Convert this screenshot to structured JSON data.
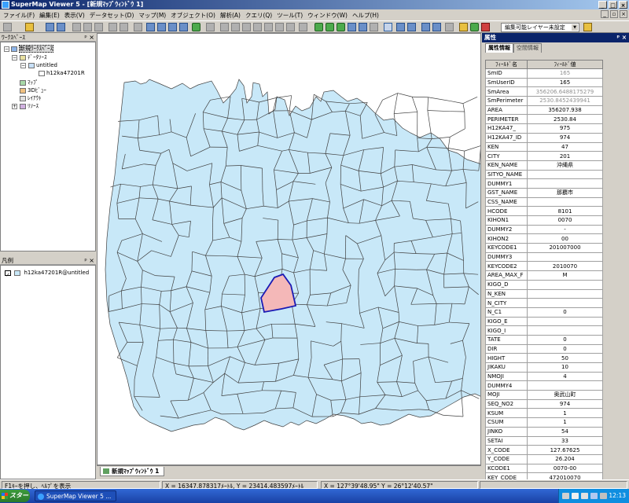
{
  "window": {
    "title": "SuperMap Viewer 5 - [新規ﾏｯﾌﾟｳｨﾝﾄﾞｳ 1]"
  },
  "menu": [
    "ファイル(F)",
    "編集(E)",
    "表示(V)",
    "データセット(D)",
    "マップ(M)",
    "オブジェクト(O)",
    "解析(A)",
    "クエリ(Q)",
    "ツール(T)",
    "ウィンドウ(W)",
    "ヘルプ(H)"
  ],
  "toolbar": {
    "layer_select": "編集可能レイヤー未設定"
  },
  "workspace": {
    "title": "ﾜｰｸｽﾍﾟｰｽ",
    "tree": {
      "root": "新規ﾜｰｸｽﾍﾟｰｽ",
      "datasource": "ﾃﾞｰﾀｿｰｽ",
      "untitled": "untitled",
      "dataset": "h12ka47201R",
      "map": "ﾏｯﾌﾟ",
      "scene": "3Dﾋﾞｭｰ",
      "layout": "ﾚｲｱｳﾄ",
      "resource": "ﾘｿｰｽ"
    }
  },
  "legend": {
    "title": "凡例",
    "item": "h12ka47201R@untitled"
  },
  "map_tab": "新規ﾏｯﾌﾟｳｨﾝﾄﾞｳ 1",
  "attributes": {
    "title": "属性",
    "tabs": [
      "属性情報",
      "空間情報"
    ],
    "columns": [
      "ﾌｨｰﾙﾄﾞ名",
      "ﾌｨｰﾙﾄﾞ値"
    ],
    "rows": [
      [
        "SmID",
        "165"
      ],
      [
        "SmUserID",
        "165"
      ],
      [
        "SmArea",
        "356206.6488175279"
      ],
      [
        "SmPerimeter",
        "2530.8452439941"
      ],
      [
        "AREA",
        "356207.938"
      ],
      [
        "PERIMETER",
        "2530.84"
      ],
      [
        "H12KA47_",
        "975"
      ],
      [
        "H12KA47_ID",
        "974"
      ],
      [
        "KEN",
        "47"
      ],
      [
        "CITY",
        "201"
      ],
      [
        "KEN_NAME",
        "沖縄県"
      ],
      [
        "SITYO_NAME",
        ""
      ],
      [
        "DUMMY1",
        ""
      ],
      [
        "GST_NAME",
        "那覇市"
      ],
      [
        "CSS_NAME",
        ""
      ],
      [
        "HCODE",
        "8101"
      ],
      [
        "KIHON1",
        "0070"
      ],
      [
        "DUMMY2",
        "-"
      ],
      [
        "KIHON2",
        "00"
      ],
      [
        "KEYCODE1",
        "201007000"
      ],
      [
        "DUMMY3",
        ""
      ],
      [
        "KEYCODE2",
        "2010070"
      ],
      [
        "AREA_MAX_F",
        "M"
      ],
      [
        "KIGO_D",
        ""
      ],
      [
        "N_KEN",
        ""
      ],
      [
        "N_CITY",
        ""
      ],
      [
        "N_C1",
        "0"
      ],
      [
        "KIGO_E",
        ""
      ],
      [
        "KIGO_I",
        ""
      ],
      [
        "TATE",
        "0"
      ],
      [
        "DIR",
        "0"
      ],
      [
        "HIGHT",
        "50"
      ],
      [
        "JIKAKU",
        "10"
      ],
      [
        "NMOJI",
        "4"
      ],
      [
        "DUMMY4",
        ""
      ],
      [
        "MOJI",
        "奥武山町"
      ],
      [
        "SEQ_NO2",
        "974"
      ],
      [
        "KSUM",
        "1"
      ],
      [
        "CSUM",
        "1"
      ],
      [
        "JINKO",
        "54"
      ],
      [
        "SETAI",
        "33"
      ],
      [
        "X_CODE",
        "127.67625"
      ],
      [
        "Y_CODE",
        "26.204"
      ],
      [
        "KCODE1",
        "0070-00"
      ],
      [
        "KEY_CODE",
        "472010070"
      ]
    ]
  },
  "status": {
    "hint": "F1ｷｰを押し、ﾍﾙﾌﾟを表示",
    "coords_m": "X = 16347.878317ﾒｰﾄﾙ, Y = 23414.483597ﾒｰﾄﾙ",
    "coords_deg": "X = 127°39'48.95\"  Y = 26°12'40.57\""
  },
  "taskbar": {
    "start": "スタート",
    "app": "SuperMap Viewer 5 ...",
    "clock": "12:13"
  },
  "colors": {
    "land": "#c8e8f8",
    "selected_fill": "#f4b8b8",
    "selected_border": "#1a1ab4",
    "boundary": "#404040"
  }
}
